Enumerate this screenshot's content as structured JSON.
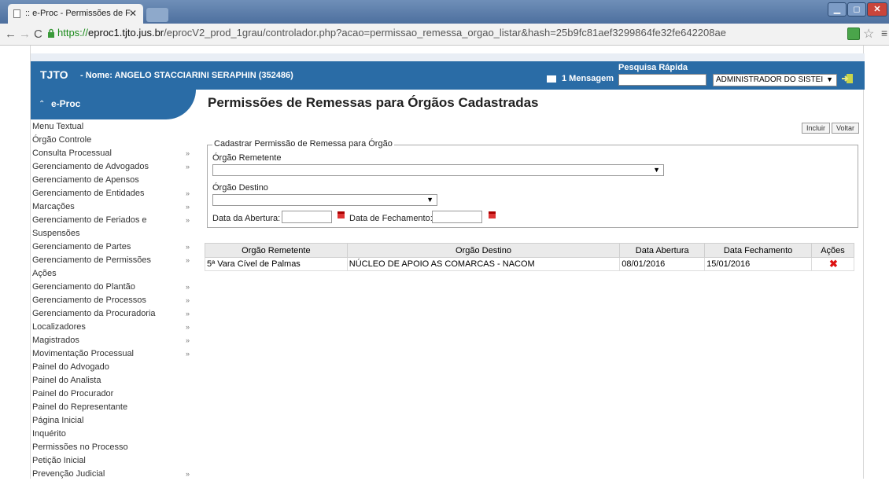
{
  "browser": {
    "tab_title": ":: e-Proc - Permissões de F",
    "url_scheme": "https://",
    "url_host": "eproc1.tjto.jus.br",
    "url_path": "/eprocV2_prod_1grau/controlador.php?acao=permissao_remessa_orgao_listar&hash=25b9fc81aef3299864fe32fe642208ae"
  },
  "header": {
    "title": "TJTO",
    "user": " - Nome: ANGELO STACCIARINI SERAPHIN (352486)",
    "messages": "1 Mensagem",
    "quick_search_label": "Pesquisa Rápida",
    "role": "ADMINISTRADOR DO SISTEI"
  },
  "sidebar": {
    "title": "e-Proc",
    "items": [
      {
        "label": "Menu Textual",
        "more": ""
      },
      {
        "label": "Órgão Controle",
        "more": ""
      },
      {
        "label": "Consulta Processual",
        "more": "»"
      },
      {
        "label": "Gerenciamento de Advogados",
        "more": "»"
      },
      {
        "label": "Gerenciamento de Apensos",
        "more": ""
      },
      {
        "label": "Gerenciamento de Entidades",
        "more": "»"
      },
      {
        "label": "Marcações",
        "more": "»"
      },
      {
        "label": "Gerenciamento de Feriados e Suspensões",
        "more": "»"
      },
      {
        "label": "Gerenciamento de Partes",
        "more": "»"
      },
      {
        "label": "Gerenciamento de Permissões",
        "more": "»"
      },
      {
        "label": "Ações",
        "more": ""
      },
      {
        "label": "Gerenciamento do Plantão",
        "more": "»"
      },
      {
        "label": "Gerenciamento de Processos",
        "more": "»"
      },
      {
        "label": "Gerenciamento da Procuradoria",
        "more": "»"
      },
      {
        "label": "Localizadores",
        "more": "»"
      },
      {
        "label": "Magistrados",
        "more": "»"
      },
      {
        "label": "Movimentação Processual",
        "more": "»"
      },
      {
        "label": "Painel do Advogado",
        "more": ""
      },
      {
        "label": "Painel do Analista",
        "more": ""
      },
      {
        "label": "Painel do Procurador",
        "more": ""
      },
      {
        "label": "Painel do Representante",
        "more": ""
      },
      {
        "label": "Página Inicial",
        "more": ""
      },
      {
        "label": "Inquérito",
        "more": ""
      },
      {
        "label": "Permissões no Processo",
        "more": ""
      },
      {
        "label": "Petição Inicial",
        "more": ""
      },
      {
        "label": "Prevenção Judicial",
        "more": "»"
      }
    ]
  },
  "main": {
    "title": "Permissões de Remessas para Órgãos Cadastradas",
    "btn_incluir": "Incluir",
    "btn_voltar": "Voltar",
    "form": {
      "legend": "Cadastrar Permissão de Remessa para Órgão",
      "orgao_remetente_label": "Órgão Remetente",
      "orgao_destino_label": "Órgão Destino",
      "data_abertura_label": "Data da Abertura:",
      "data_fechamento_label": "Data de Fechamento:"
    },
    "table": {
      "columns": [
        "Orgão Remetente",
        "Orgão Destino",
        "Data Abertura",
        "Data Fechamento",
        "Ações"
      ],
      "rows": [
        {
          "remetente": "5ª Vara Cível de Palmas",
          "destino": "NÚCLEO DE APOIO AS COMARCAS - NACOM",
          "abertura": "08/01/2016",
          "fechamento": "15/01/2016",
          "acao": "✖"
        }
      ]
    }
  }
}
